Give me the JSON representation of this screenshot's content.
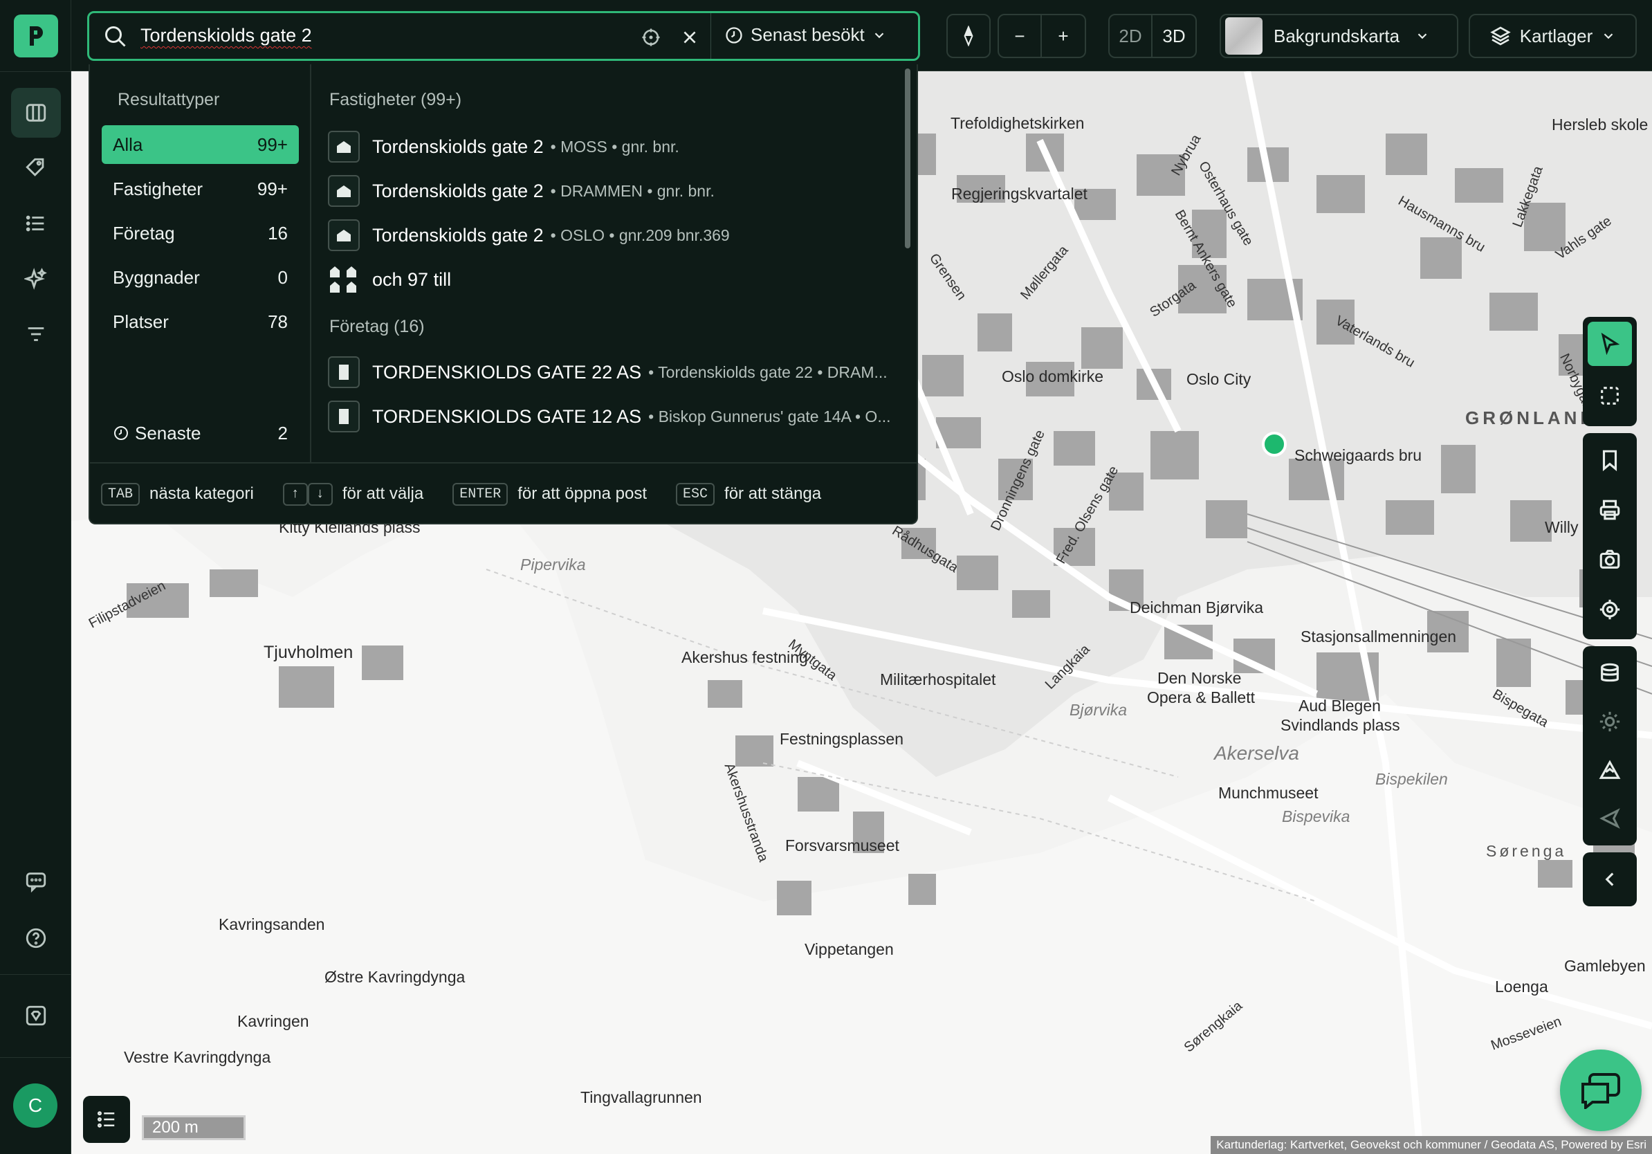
{
  "topbar": {
    "search_value": "Tordenskiolds gate 2",
    "recent_label": "Senast besökt",
    "view_2d": "2D",
    "view_3d": "3D",
    "zoom_out": "−",
    "zoom_in": "+",
    "basemap_label": "Bakgrundskarta",
    "layers_label": "Kartlager"
  },
  "sidebar": {
    "logo_icon": "app-logo-icon",
    "items": [
      {
        "name": "map-icon",
        "active": true
      },
      {
        "name": "tag-icon"
      },
      {
        "name": "list-icon"
      },
      {
        "name": "sparkle-icon"
      },
      {
        "name": "filter-icon"
      }
    ],
    "bottom": [
      {
        "name": "feedback-icon"
      },
      {
        "name": "help-icon"
      },
      {
        "name": "premium-icon"
      }
    ],
    "avatar_initial": "C"
  },
  "dropdown": {
    "categories_heading": "Resultattyper",
    "categories": [
      {
        "label": "Alla",
        "count": "99+",
        "active": true
      },
      {
        "label": "Fastigheter",
        "count": "99+"
      },
      {
        "label": "Företag",
        "count": "16"
      },
      {
        "label": "Byggnader",
        "count": "0"
      },
      {
        "label": "Platser",
        "count": "78"
      }
    ],
    "recent": {
      "label": "Senaste",
      "count": "2"
    },
    "sections": {
      "properties_heading": "Fastigheter (99+)",
      "properties": [
        {
          "title": "Tordenskiolds gate 2",
          "sub": "• MOSS • gnr. bnr."
        },
        {
          "title": "Tordenskiolds gate 2",
          "sub": "• DRAMMEN • gnr. bnr."
        },
        {
          "title": "Tordenskiolds gate 2",
          "sub": "• OSLO • gnr.209 bnr.369"
        }
      ],
      "more_label": "och 97 till",
      "companies_heading": "Företag (16)",
      "companies": [
        {
          "title": "TORDENSKIOLDS GATE 22 AS",
          "sub": "• Tordenskiolds gate 22 • DRAM..."
        },
        {
          "title": "TORDENSKIOLDS GATE 12 AS",
          "sub": "• Biskop Gunnerus' gate 14A • O..."
        }
      ]
    },
    "footer": {
      "tab_key": "TAB",
      "tab_text": "nästa kategori",
      "up_key": "↑",
      "down_key": "↓",
      "arrows_text": "för att välja",
      "enter_key": "ENTER",
      "enter_text": "för att öppna post",
      "esc_key": "ESC",
      "esc_text": "för att stänga"
    }
  },
  "map": {
    "labels": [
      "Trefoldighetskirken",
      "Regjeringskvartalet",
      "Oslo domkirke",
      "Oslo City",
      "Schweigaards bru",
      "GRØNLAND",
      "Deichman Bjørvika",
      "Stasjonsallmenningen",
      "Den Norske",
      "Opera & Ballett",
      "Aud Blegen",
      "Svindlands plass",
      "Munchmuseet",
      "Akershus festning",
      "Militærhospitalet",
      "Festningsplassen",
      "Forsvarsmuseet",
      "Vippetangen",
      "Tjuvholmen",
      "Kavringsanden",
      "Østre Kavringdynga",
      "Kavringen",
      "Vestre Kavringdynga",
      "Tingvallagrunnen",
      "Loenga",
      "Gamlebyen",
      "Hersleb skole",
      "Willy",
      "Kitty Kiellands plass",
      "Pipervika",
      "Bjørvika",
      "Akerselva",
      "Bispekilen",
      "Bispevika",
      "Sørenga",
      "Myntgata",
      "Rådhusgata",
      "Storgata",
      "Møllergata",
      "Grensen",
      "Langkaia",
      "Akershusstranda",
      "Fred. Olsens gate",
      "Dronningens gate",
      "Vaterlands bru",
      "Hausmanns bru",
      "Bispegata",
      "Mosseveien",
      "Sørengkaia",
      "Filipstadveien",
      "Nybrua",
      "Lakkegata",
      "Vahls gate",
      "Norbygata",
      "Osterhaus gate",
      "Bernt Ankers gate"
    ],
    "scale_label": "200 m",
    "attribution": "Kartunderlag: Kartverket, Geovekst och kommuner / Geodata AS, Powered by Esri"
  },
  "right_toolbar": {
    "group1": [
      "pointer-icon",
      "select-area-icon"
    ],
    "group2": [
      "bookmark-icon",
      "print-icon",
      "camera-icon",
      "locate-icon"
    ],
    "group3": [
      "database-icon",
      "sun-icon",
      "terrain-icon",
      "navigate-icon"
    ],
    "collapse": "chevron-left-icon"
  },
  "colors": {
    "accent": "#3bc487",
    "panel": "#0e1b17",
    "marker": "#1db86e"
  }
}
